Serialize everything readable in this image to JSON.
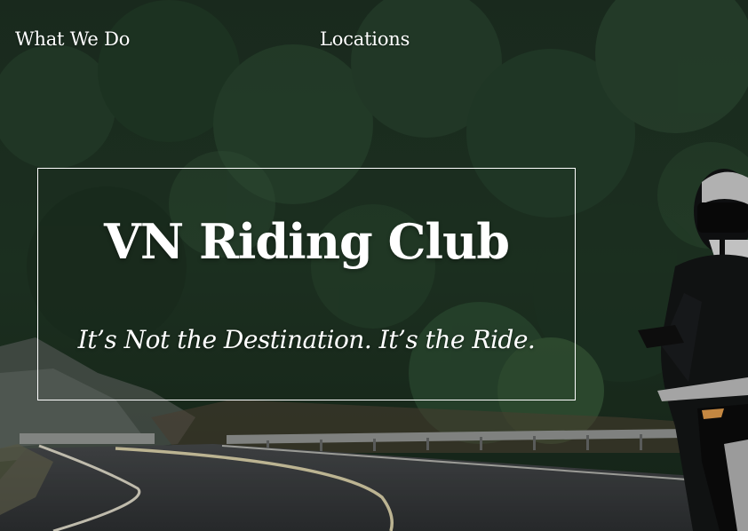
{
  "nav": {
    "items": [
      {
        "label": "What We Do"
      },
      {
        "label": "Locations"
      }
    ]
  },
  "hero": {
    "title": "VN Riding Club",
    "tagline": "It’s Not the Destination. It’s the Ride."
  },
  "colors": {
    "text": "#ffffff",
    "forest_dark": "#152319",
    "forest_mid": "#25402c",
    "road": "#3a3d3f"
  }
}
